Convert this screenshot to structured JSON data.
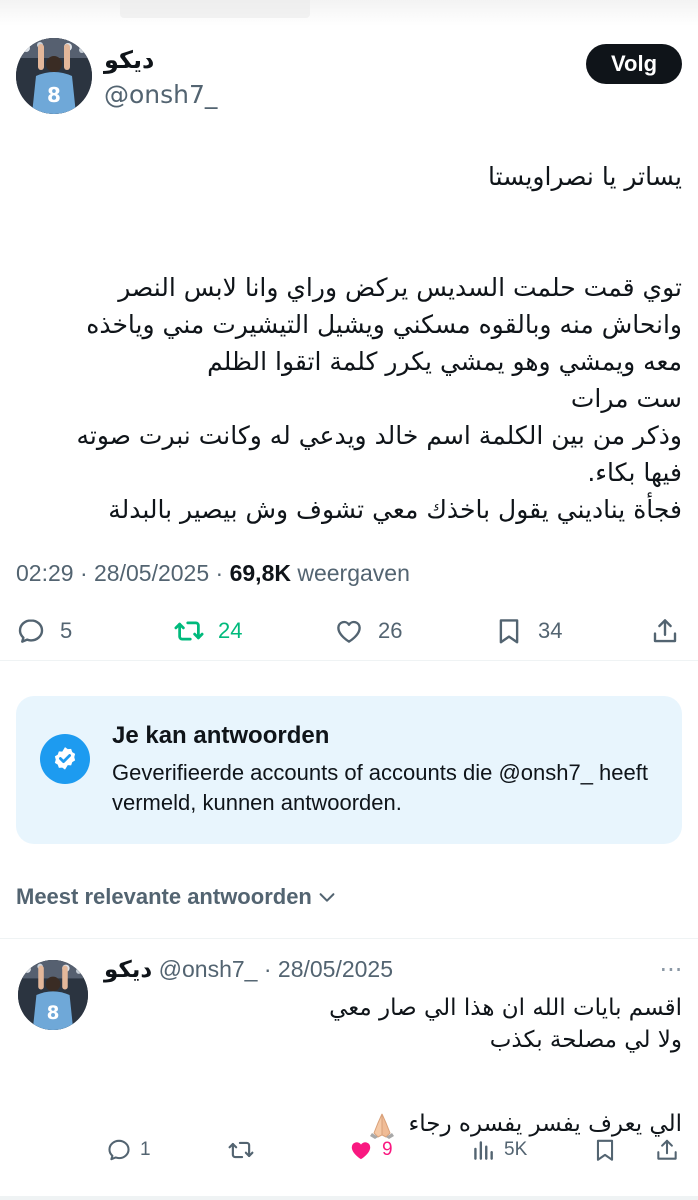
{
  "header": {
    "author_name": "ديكو",
    "author_handle": "@onsh7_",
    "follow_label": "Volg"
  },
  "tweet": {
    "lines": [
      "يساتر يا نصراويستا",
      "",
      "",
      "توي قمت حلمت السديس يركض وراي وانا لابس النصر",
      "وانحاش منه وبالقوه مسكني ويشيل التيشيرت مني وياخذه",
      "معه ويمشي وهو يمشي يكرر كلمة اتقوا الظلم",
      "ست مرات",
      "وذكر من بين الكلمة اسم خالد ويدعي له وكانت نبرت صوته",
      "فيها بكاء.",
      "فجأة يناديني يقول باخذك معي تشوف وش بيصير بالبدلة"
    ],
    "time": "02:29",
    "date": "28/05/2025",
    "views": "69,8K",
    "views_label": "weergaven",
    "replies": "5",
    "reposts": "24",
    "likes": "26",
    "bookmarks": "34"
  },
  "reply_notice": {
    "title": "Je kan antwoorden",
    "text": "Geverifieerde accounts of accounts die @onsh7_ heeft vermeld, kunnen antwoorden."
  },
  "sort_label": "Meest relevante antwoorden",
  "reply": {
    "name": "ديكو",
    "handle": "@onsh7_",
    "date": "28/05/2025",
    "line1": "اقسم بايات الله ان هذا الي صار معي",
    "line2": "ولا لي مصلحة بكذب",
    "line3": "الي يعرف يفسر يفسره رجاء",
    "replies": "1",
    "likes": "9",
    "views": "5K"
  },
  "colors": {
    "repost_active": "#00ba7c",
    "like_active": "#f91880",
    "accent": "#1d9bf0",
    "muted": "#536471"
  },
  "icons": [
    "reply-icon",
    "repost-icon",
    "like-icon",
    "bookmark-icon",
    "share-icon",
    "verified-icon",
    "chevron-down-icon",
    "views-icon",
    "more-icon",
    "folded-hands-emoji"
  ]
}
